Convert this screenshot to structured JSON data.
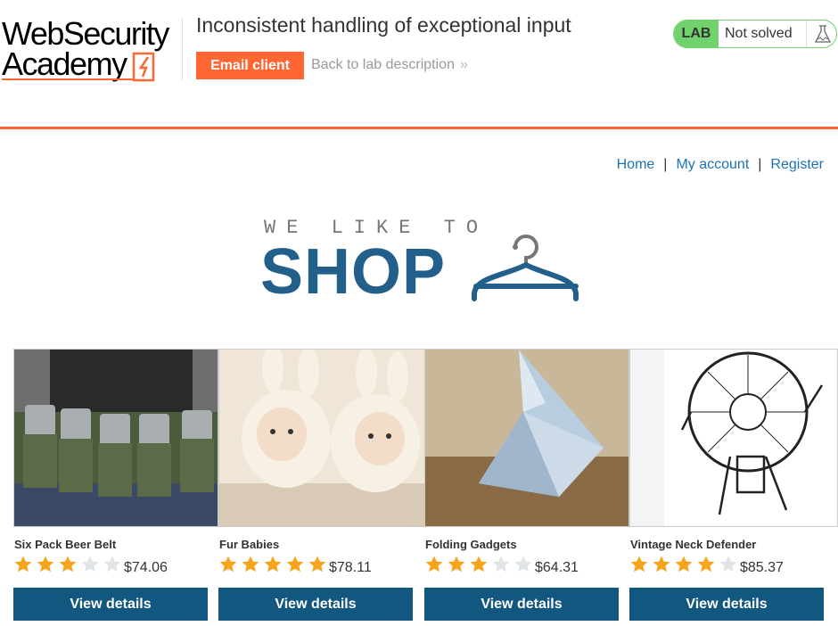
{
  "header": {
    "logo_line1": "WebSecurity",
    "logo_line2": "Academy",
    "lab_title": "Inconsistent handling of exceptional input",
    "email_client": "Email client",
    "back_link": "Back to lab description",
    "lab_badge": "LAB",
    "lab_status": "Not solved",
    "accent_color": "#ff6633",
    "status_color": "#70d16d"
  },
  "nav": {
    "home": "Home",
    "separator": "|",
    "my_account": "My account",
    "register": "Register"
  },
  "banner": {
    "tagline": "WE LIKE TO",
    "title": "SHOP",
    "icon": "hanger-icon"
  },
  "products": [
    {
      "name": "Six Pack Beer Belt",
      "rating": 3,
      "price": "$74.06",
      "button": "View details"
    },
    {
      "name": "Fur Babies",
      "rating": 5,
      "price": "$78.11",
      "button": "View details"
    },
    {
      "name": "Folding Gadgets",
      "rating": 3,
      "price": "$64.31",
      "button": "View details"
    },
    {
      "name": "Vintage Neck Defender",
      "rating": 4,
      "price": "$85.37",
      "button": "View details"
    }
  ],
  "colors": {
    "button": "#12577f",
    "star_filled": "#f7a41d",
    "star_empty": "#e0e4e8",
    "link": "#1a73b8"
  }
}
